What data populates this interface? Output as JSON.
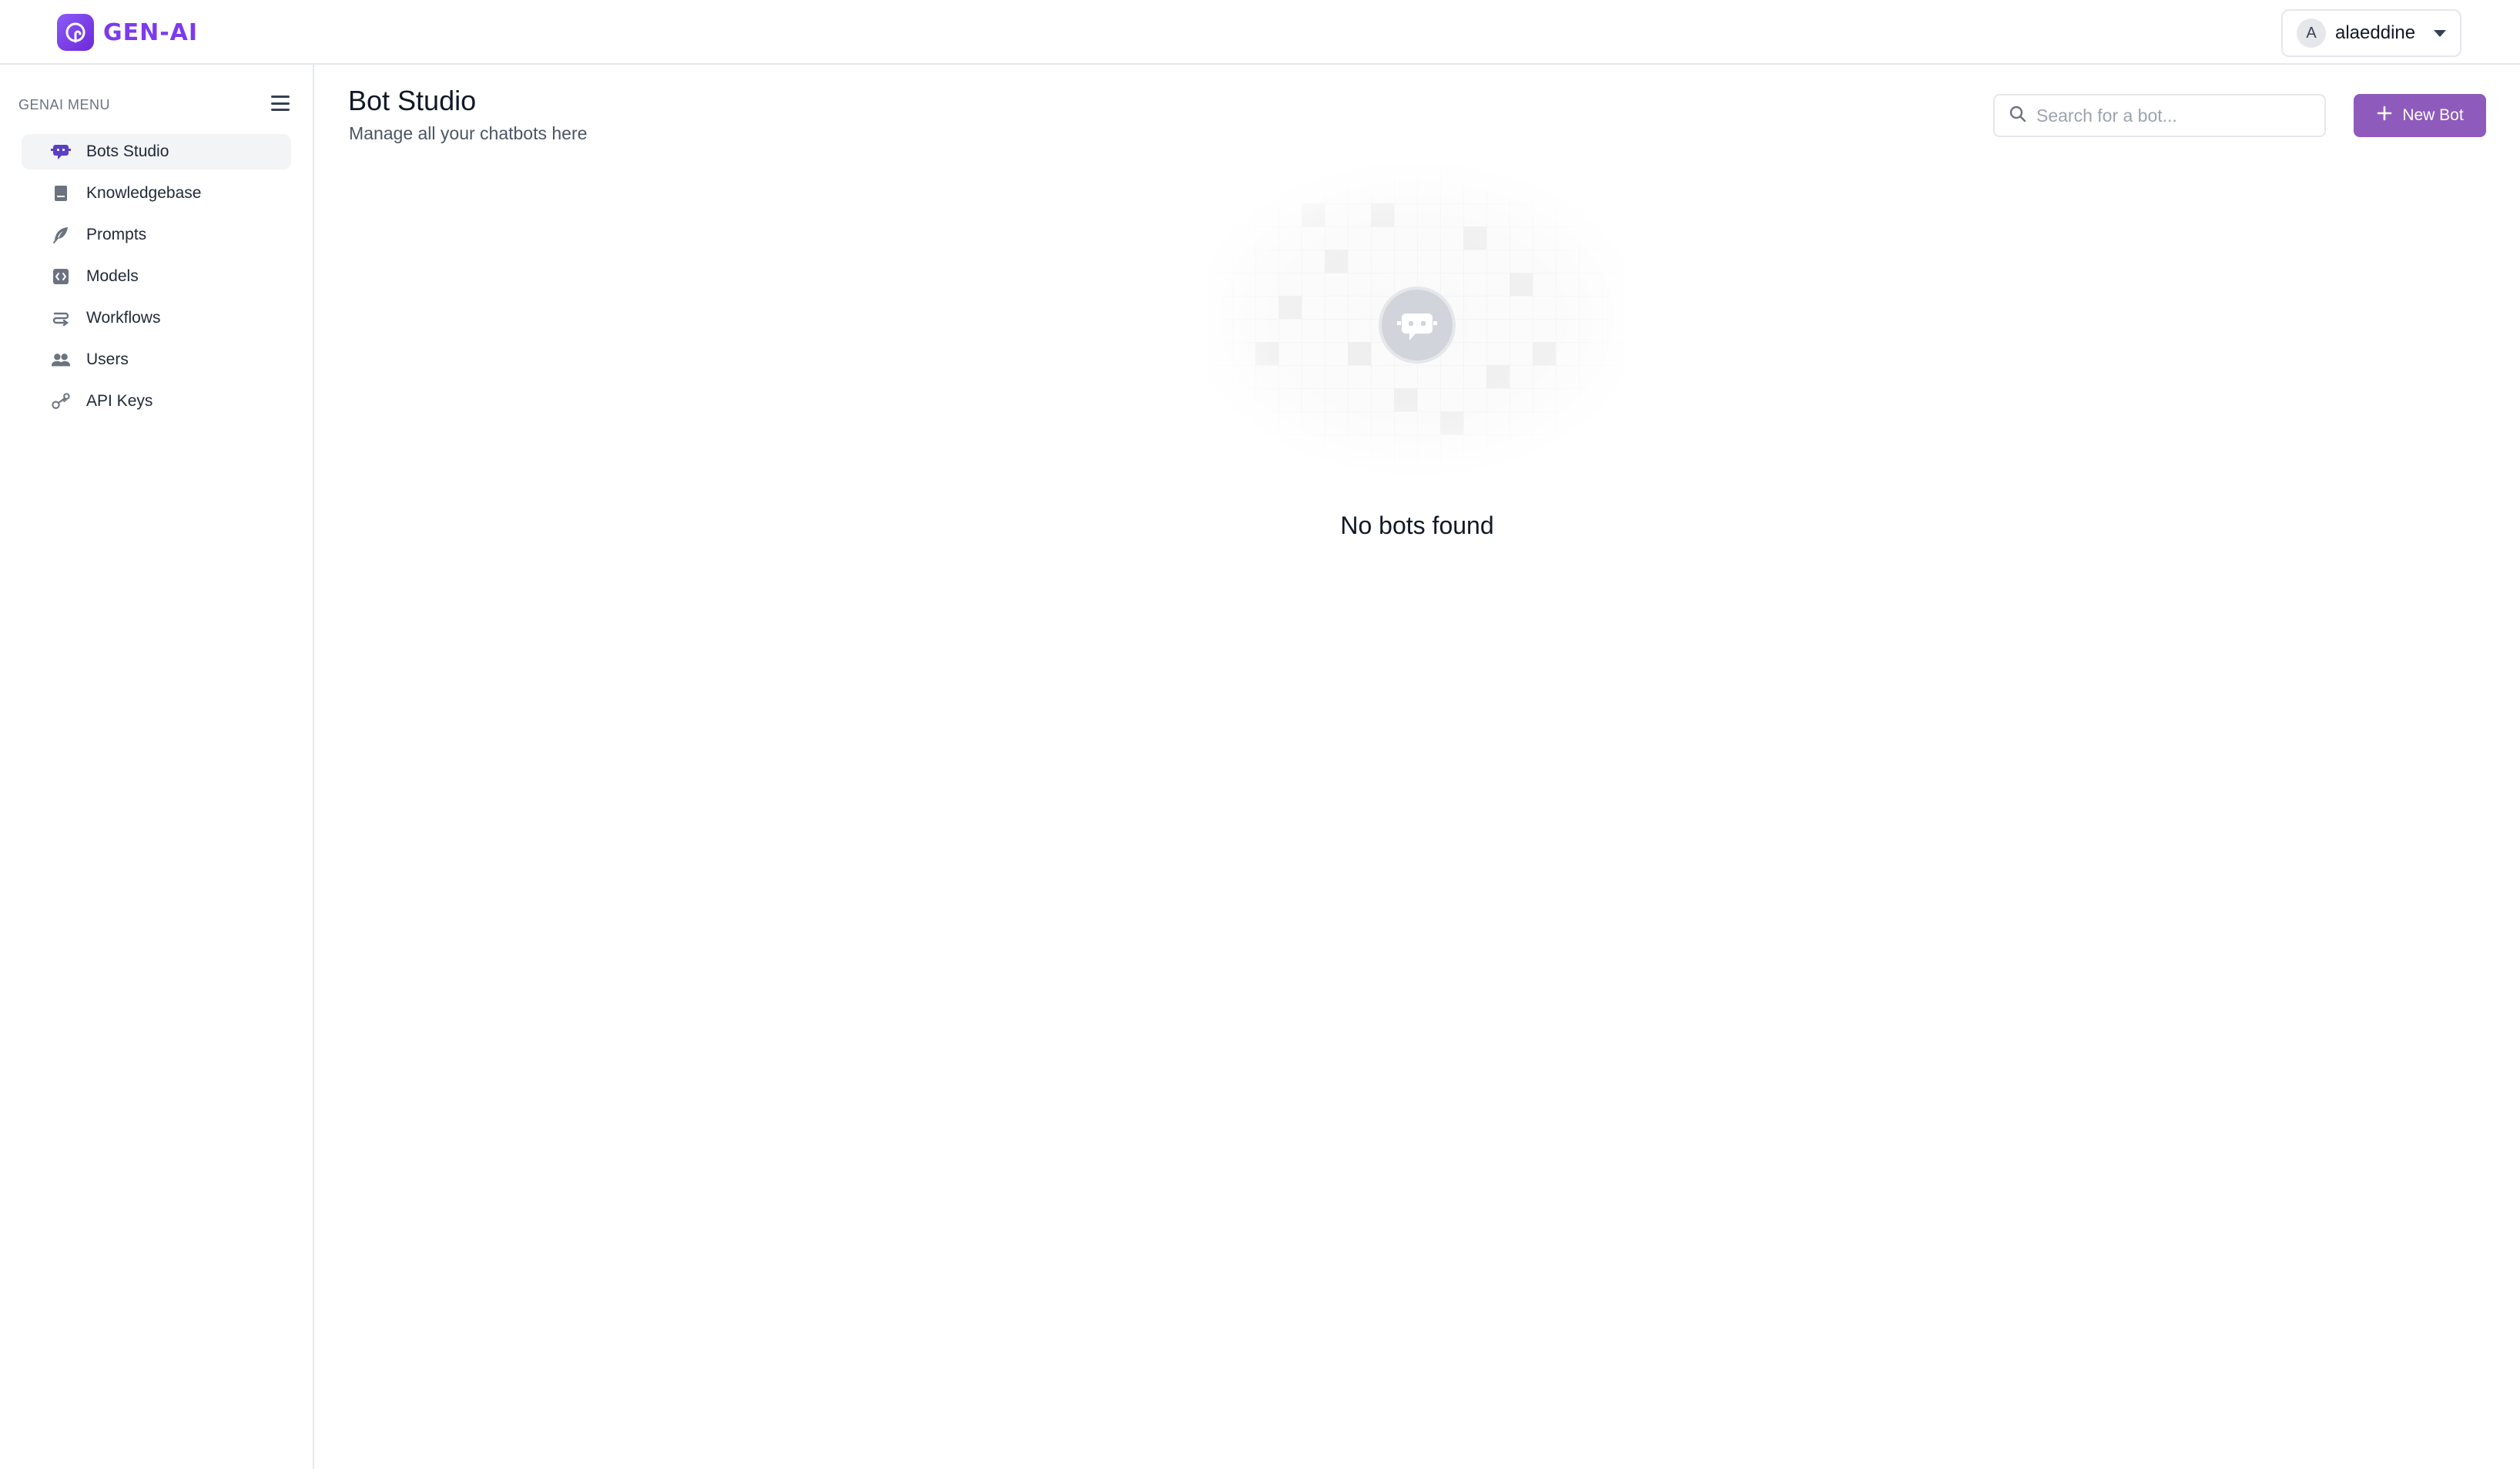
{
  "app": {
    "brand": "GEN-AI",
    "logo_icon": "genai-logo-icon"
  },
  "user": {
    "initial": "A",
    "name": "alaeddine"
  },
  "sidebar": {
    "header": "GENAI MENU",
    "items": [
      {
        "label": "Bots Studio",
        "icon": "bot-chat-icon",
        "active": true
      },
      {
        "label": "Knowledgebase",
        "icon": "book-icon",
        "active": false
      },
      {
        "label": "Prompts",
        "icon": "feather-icon",
        "active": false
      },
      {
        "label": "Models",
        "icon": "model-box-icon",
        "active": false
      },
      {
        "label": "Workflows",
        "icon": "workflow-icon",
        "active": false
      },
      {
        "label": "Users",
        "icon": "users-icon",
        "active": false
      },
      {
        "label": "API Keys",
        "icon": "key-icon",
        "active": false
      }
    ]
  },
  "main": {
    "title": "Bot Studio",
    "subtitle": "Manage all your chatbots here",
    "search": {
      "placeholder": "Search for a bot...",
      "value": ""
    },
    "new_bot_label": "New Bot",
    "empty_state": {
      "message": "No bots found",
      "icon": "bot-chat-icon"
    }
  },
  "colors": {
    "accent": "#8e5bbd",
    "brand": "#7c3aed",
    "active_nav_icon": "#5b3fc4",
    "nav_icon": "#6b7280"
  }
}
